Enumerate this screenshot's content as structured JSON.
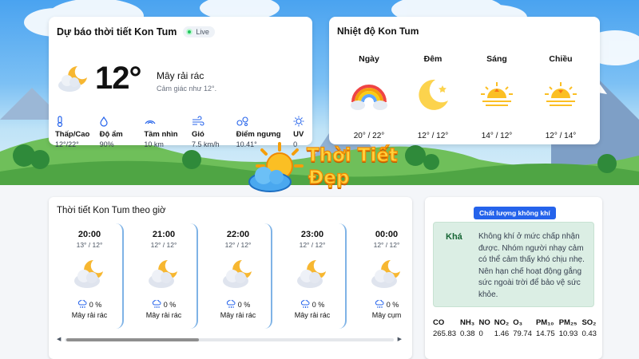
{
  "current": {
    "title": "Dự báo thời tiết Kon Tum",
    "live_label": "Live",
    "temperature": "12°",
    "condition": "Mây rải rác",
    "feels_like": "Cảm giác như 12°.",
    "icon": "moon-cloud-icon",
    "metrics": [
      {
        "icon": "thermometer-icon",
        "label": "Thấp/Cao",
        "value": "12°/22°"
      },
      {
        "icon": "humidity-icon",
        "label": "Độ ẩm",
        "value": "90%"
      },
      {
        "icon": "visibility-icon",
        "label": "Tầm nhìn",
        "value": "10 km"
      },
      {
        "icon": "wind-icon",
        "label": "Gió",
        "value": "7.5 km/h"
      },
      {
        "icon": "dew-point-icon",
        "label": "Điểm ngưng",
        "value": "10.41°"
      },
      {
        "icon": "uv-icon",
        "label": "UV",
        "value": "0"
      }
    ]
  },
  "daily": {
    "title": "Nhiệt độ Kon Tum",
    "periods": [
      {
        "name": "Ngày",
        "temps": "20° / 22°",
        "icon": "rainbow-cloud-icon"
      },
      {
        "name": "Đêm",
        "temps": "12° / 12°",
        "icon": "crescent-moon-icon"
      },
      {
        "name": "Sáng",
        "temps": "14° / 12°",
        "icon": "sunrise-icon"
      },
      {
        "name": "Chiều",
        "temps": "12° / 14°",
        "icon": "sunset-icon"
      }
    ]
  },
  "logo": {
    "line1": "Thời Tiết",
    "line2": "Đẹp"
  },
  "hourly": {
    "title": "Thời tiết Kon Tum theo giờ",
    "hours": [
      {
        "time": "20:00",
        "range": "13° / 12°",
        "precip": "0 %",
        "condition": "Mây rải rác"
      },
      {
        "time": "21:00",
        "range": "12° / 12°",
        "precip": "0 %",
        "condition": "Mây rải rác"
      },
      {
        "time": "22:00",
        "range": "12° / 12°",
        "precip": "0 %",
        "condition": "Mây rải rác"
      },
      {
        "time": "23:00",
        "range": "12° / 12°",
        "precip": "0 %",
        "condition": "Mây rải rác"
      },
      {
        "time": "00:00",
        "range": "12° / 12°",
        "precip": "0 %",
        "condition": "Mây cụm"
      }
    ],
    "scroll_left": "◀",
    "scroll_right": "▶"
  },
  "air_quality": {
    "badge": "Chất lượng không khí",
    "level": "Khá",
    "description": "Không khí ở mức chấp nhận được. Nhóm người nhạy cảm có thể cảm thấy khó chịu nhẹ. Nên hạn chế hoạt động gắng sức ngoài trời để bảo vệ sức khỏe.",
    "pollutants": [
      {
        "name": "CO",
        "value": "265.83"
      },
      {
        "name": "NH₃",
        "value": "0.38"
      },
      {
        "name": "NO",
        "value": "0"
      },
      {
        "name": "NO₂",
        "value": "1.46"
      },
      {
        "name": "O₃",
        "value": "79.74"
      },
      {
        "name": "PM₁₀",
        "value": "14.75"
      },
      {
        "name": "PM₂₅",
        "value": "10.93"
      },
      {
        "name": "SO₂",
        "value": "0.43"
      }
    ]
  },
  "colors": {
    "accent": "#2563eb",
    "live": "#22c55e",
    "aq_box": "#dbeee4",
    "logo": "#ffd23f"
  }
}
